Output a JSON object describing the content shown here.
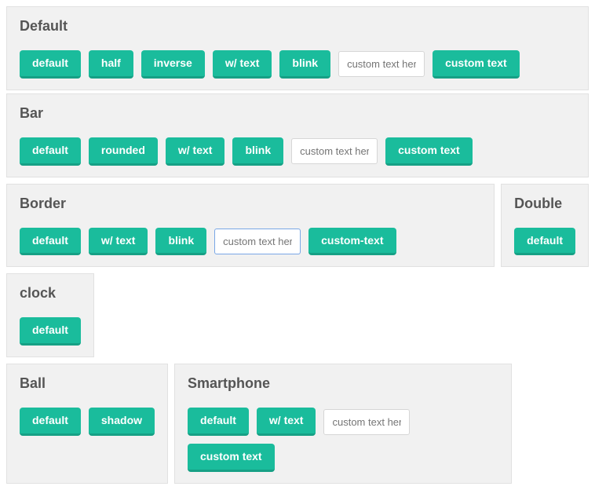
{
  "sections": {
    "default": {
      "title": "Default",
      "buttons": [
        "default",
        "half",
        "inverse",
        "w/ text",
        "blink"
      ],
      "input_placeholder": "custom text here",
      "after_input_button": "custom text"
    },
    "bar": {
      "title": "Bar",
      "buttons": [
        "default",
        "rounded",
        "w/ text",
        "blink"
      ],
      "input_placeholder": "custom text here",
      "after_input_button": "custom text"
    },
    "border": {
      "title": "Border",
      "buttons": [
        "default",
        "w/ text",
        "blink"
      ],
      "input_placeholder": "custom text here",
      "after_input_button": "custom-text"
    },
    "double": {
      "title": "Double",
      "buttons": [
        "default"
      ]
    },
    "clock": {
      "title": "clock",
      "buttons": [
        "default"
      ]
    },
    "ball": {
      "title": "Ball",
      "buttons": [
        "default",
        "shadow"
      ]
    },
    "smartphone": {
      "title": "Smartphone",
      "buttons": [
        "default",
        "w/ text"
      ],
      "input_placeholder": "custom text here",
      "after_input_button": "custom text"
    }
  }
}
